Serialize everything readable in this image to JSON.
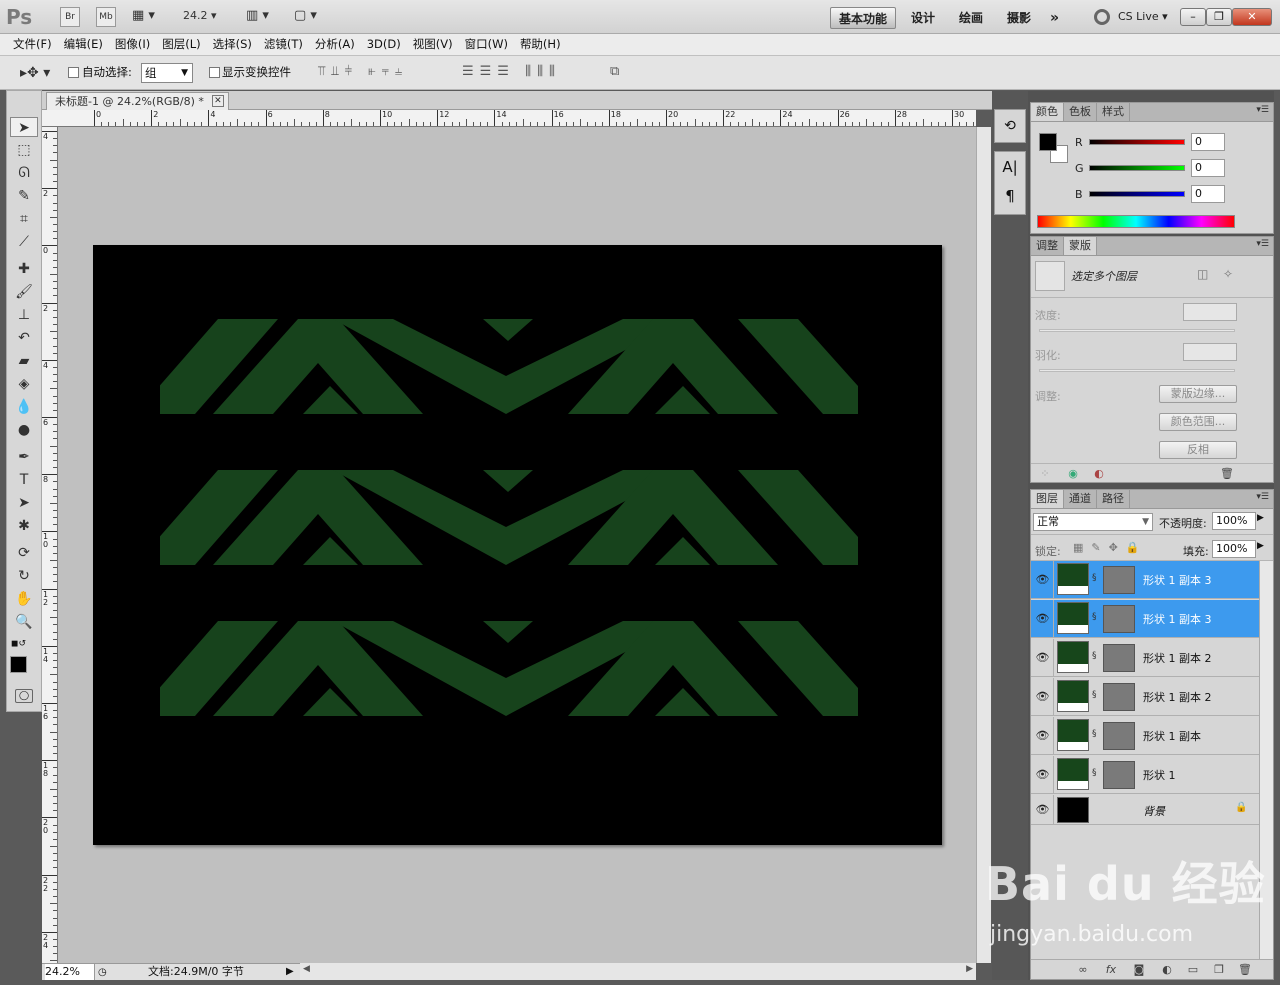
{
  "app": {
    "logo": "Ps",
    "zoom_combo": "24.2",
    "bridge_btn": "Br",
    "minibridge_btn": "Mb"
  },
  "workspaces": [
    "基本功能",
    "设计",
    "绘画",
    "摄影"
  ],
  "cslive": "CS Live",
  "menu": [
    "文件(F)",
    "编辑(E)",
    "图像(I)",
    "图层(L)",
    "选择(S)",
    "滤镜(T)",
    "分析(A)",
    "3D(D)",
    "视图(V)",
    "窗口(W)",
    "帮助(H)"
  ],
  "options": {
    "auto_select_label": "自动选择:",
    "auto_select_value": "组",
    "show_transform_label": "显示变换控件"
  },
  "document": {
    "tab_title": "未标题-1 @ 24.2%(RGB/8) *",
    "zoom_status": "24.2%",
    "doc_info": "文档:24.9M/0 字节"
  },
  "rulers": {
    "h": [
      "0",
      "2",
      "4",
      "6",
      "8",
      "10",
      "12",
      "14",
      "16",
      "18",
      "20",
      "22",
      "24",
      "26",
      "28",
      "30"
    ],
    "v": [
      "4",
      "2",
      "0",
      "2",
      "4",
      "6",
      "8",
      "1 0",
      "1 2",
      "1 4",
      "1 6",
      "1 8",
      "2 0",
      "2 2",
      "2 4"
    ]
  },
  "canvas": {
    "stripe_color": "#17431c",
    "background": "#000000",
    "pattern_rows": 3
  },
  "color_panel": {
    "tabs": [
      "颜色",
      "色板",
      "样式"
    ],
    "r_label": "R",
    "g_label": "G",
    "b_label": "B",
    "r": "0",
    "g": "0",
    "b": "0"
  },
  "masks_panel": {
    "tabs": [
      "调整",
      "蒙版"
    ],
    "status": "选定多个图层",
    "density_label": "浓度:",
    "feather_label": "羽化:",
    "refine_label": "调整:",
    "mask_edge_btn": "蒙版边缘...",
    "color_range_btn": "颜色范围...",
    "invert_btn": "反相"
  },
  "layers_panel": {
    "tabs": [
      "图层",
      "通道",
      "路径"
    ],
    "blend_mode": "正常",
    "opacity_label": "不透明度:",
    "opacity": "100%",
    "lock_label": "锁定:",
    "fill_label": "填充:",
    "fill": "100%",
    "layers": [
      {
        "name": "形状 1 副本 3",
        "selected": true
      },
      {
        "name": "形状 1 副本 3",
        "selected": true
      },
      {
        "name": "形状 1 副本 2",
        "selected": false
      },
      {
        "name": "形状 1 副本 2",
        "selected": false
      },
      {
        "name": "形状 1 副本",
        "selected": false
      },
      {
        "name": "形状 1",
        "selected": false
      }
    ],
    "background_layer": "背景"
  },
  "watermark": {
    "brand": "Bai du 经验",
    "url": "jingyan.baidu.com"
  }
}
